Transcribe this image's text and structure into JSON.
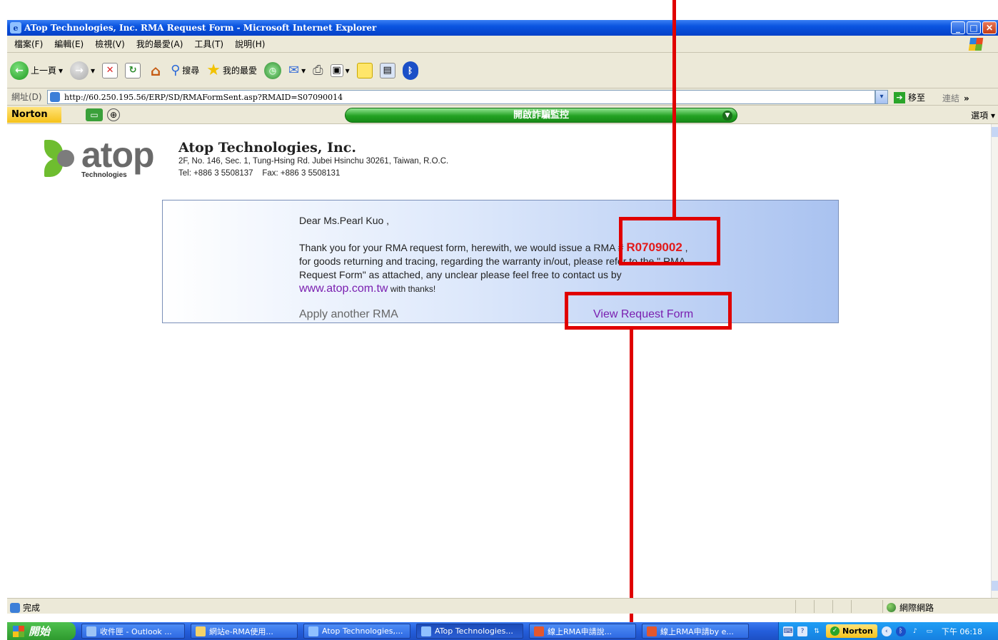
{
  "window": {
    "title": "ATop Technologies, Inc. RMA Request Form - Microsoft Internet Explorer"
  },
  "menu": [
    "檔案(F)",
    "編輯(E)",
    "檢視(V)",
    "我的最愛(A)",
    "工具(T)",
    "說明(H)"
  ],
  "toolbar": {
    "back_label": "上一頁",
    "search_label": "搜尋",
    "favorites_label": "我的最愛"
  },
  "address": {
    "label": "網址(D)",
    "url": "http://60.250.195.56/ERP/SD/RMAFormSent.asp?RMAID=S07090014",
    "go_label": "移至",
    "links_label": "連結",
    "links_more": "»"
  },
  "norton_bar": {
    "logo": "Norton",
    "center_label": "開啟詐騙監控",
    "options_label": "選項 ▾"
  },
  "company": {
    "logo_word": "atop",
    "logo_sub": "Technologies",
    "name": "Atop Technologies, Inc.",
    "address": "2F, No. 146, Sec. 1, Tung-Hsing Rd. Jubei Hsinchu 30261, Taiwan, R.O.C.",
    "tel": "Tel: +886 3 5508137    Fax: +886 3 5508131"
  },
  "message": {
    "greeting": "Dear Ms.Pearl Kuo ,",
    "line1_pre": "Thank you for your RMA request form, herewith, we would issue a RMA # ",
    "rma_number": "R0709002",
    "line1_post": " ,",
    "line2": "for goods returning and tracing, regarding the warranty in/out, please refer to the \" RMA",
    "line3": "Request Form\" as attached, any unclear please feel free to contact us by",
    "website": "www.atop.com.tw",
    "thanks": " with thanks!",
    "apply_label": "Apply another RMA",
    "view_label": "View Request Form"
  },
  "status": {
    "done_label": "完成",
    "zone_label": "網際網路"
  },
  "taskbar": {
    "start_label": "開始",
    "tasks": [
      "收件匣 - Outlook ...",
      "網站e-RMA使用...",
      "Atop Technologies,...",
      "ATop Technologies...",
      "線上RMA申請說...",
      "線上RMA申請by e..."
    ],
    "tray_norton": "Norton",
    "clock": "下午 06:18"
  },
  "colors": {
    "highlight_red": "#e00000",
    "rma_number_red": "#e21a1a",
    "link_purple": "#7a1fb0"
  }
}
